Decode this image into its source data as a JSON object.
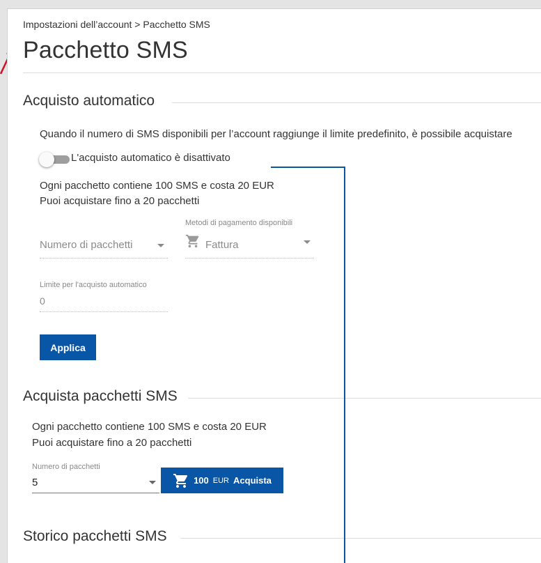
{
  "breadcrumb": "Impostazioni dell’account > Pacchetto SMS",
  "page_title": "Pacchetto SMS",
  "auto_purchase": {
    "title": "Acquisto automatico",
    "description": "Quando il numero di SMS disponibili per l’account raggiunge il limite predefinito, è possibile acquistare",
    "toggle_label": "L'acquisto automatico è disattivato",
    "toggle_on": false,
    "info_line1": "Ogni pacchetto contiene 100 SMS e costa 20 EUR",
    "info_line2": "Puoi acquistare fino a 20 pacchetti",
    "packages_placeholder": "Numero di pacchetti",
    "payment_label": "Metodi di pagamento disponibili",
    "payment_value": "Fattura",
    "limit_label": "Limite per l'acquisto automatico",
    "limit_value": "0",
    "apply_label": "Applica"
  },
  "buy_packages": {
    "title": "Acquista pacchetti SMS",
    "info_line1": "Ogni pacchetto contiene 100 SMS e costa 20 EUR",
    "info_line2": "Puoi acquistare fino a 20 pacchetti",
    "packages_label": "Numero di pacchetti",
    "packages_value": "5",
    "buy_amount": "100",
    "buy_currency": "EUR",
    "buy_label": "Acquista"
  },
  "history": {
    "title": "Storico pacchetti SMS"
  },
  "colors": {
    "primary": "#0a56a6",
    "annotation_arrow": "#d0102a"
  },
  "icons": [
    "cart-icon",
    "chevron-down-icon"
  ]
}
